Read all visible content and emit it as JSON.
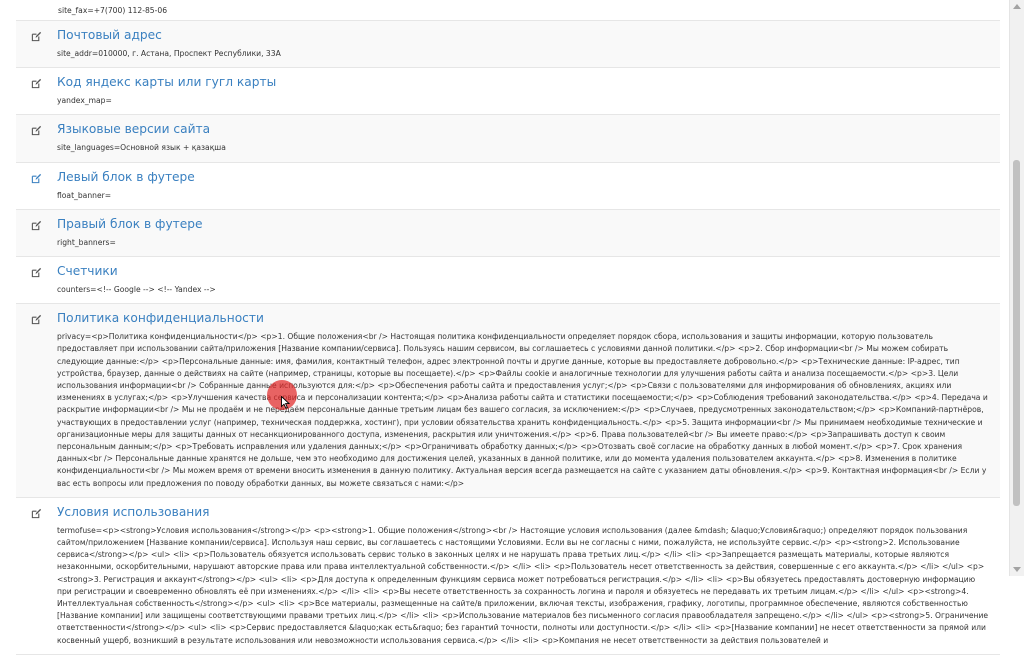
{
  "top_row": {
    "value": "site_fax=+7(700) 112-85-06"
  },
  "rows": [
    {
      "title": "Почтовый адрес",
      "value": "site_addr=010000, г. Астана, Проспект Республики, 33А"
    },
    {
      "title": "Код яндекс карты или гугл карты",
      "value": "yandex_map="
    },
    {
      "title": "Языковые версии сайта",
      "value": "site_languages=Основной язык + қазақша"
    },
    {
      "title": "Левый блок в футере",
      "value": "float_banner="
    },
    {
      "title": "Правый блок в футере",
      "value": "right_banners="
    },
    {
      "title": "Счетчики",
      "value": "counters=<!-- Google --> <!-- Yandex -->"
    },
    {
      "title": "Политика конфиденциальности",
      "value": "privacy=<p>Политика конфиденциальности</p> <p>1. Общие положения<br /> Настоящая политика конфиденциальности определяет порядок сбора, использования и защиты информации, которую пользователь предоставляет при использовании сайта/приложения [Название компании/сервиса]. Пользуясь нашим сервисом, вы соглашаетесь с условиями данной политики.</p> <p>2. Сбор информации<br /> Мы можем собирать следующие данные:</p> <p>Персональные данные: имя, фамилия, контактный телефон, адрес электронной почты и другие данные, которые вы предоставляете добровольно.</p> <p>Технические данные: IP-адрес, тип устройства, браузер, данные о действиях на сайте (например, страницы, которые вы посещаете).</p> <p>Файлы cookie и аналогичные технологии для улучшения работы сайта и анализа посещаемости.</p> <p>3. Цели использования информации<br /> Собранные данные используются для:</p> <p>Обеспечения работы сайта и предоставления услуг;</p> <p>Связи с пользователями для информирования об обновлениях, акциях или изменениях в услугах;</p> <p>Улучшения качества сервиса и персонализации контента;</p> <p>Анализа работы сайта и статистики посещаемости;</p> <p>Соблюдения требований законодательства.</p> <p>4. Передача и раскрытие информации<br /> Мы не продаём и не передаём персональные данные третьим лицам без вашего согласия, за исключением:</p> <p>Случаев, предусмотренных законодательством;</p> <p>Компаний-партнёров, участвующих в предоставлении услуг (например, техническая поддержка, хостинг), при условии обязательства хранить конфиденциальность.</p> <p>5. Защита информации<br /> Мы принимаем необходимые технические и организационные меры для защиты данных от несанкционированного доступа, изменения, раскрытия или уничтожения.</p> <p>6. Права пользователей<br /> Вы имеете право:</p> <p>Запрашивать доступ к своим персональным данным;</p> <p>Требовать исправления или удаления данных;</p> <p>Ограничивать обработку данных;</p> <p>Отозвать своё согласие на обработку данных в любой момент.</p> <p>7. Срок хранения данных<br /> Персональные данные хранятся не дольше, чем это необходимо для достижения целей, указанных в данной политике, или до момента удаления пользователем аккаунта.</p> <p>8. Изменения в политике конфиденциальности<br /> Мы можем время от времени вносить изменения в данную политику. Актуальная версия всегда размещается на сайте с указанием даты обновления.</p> <p>9. Контактная информация<br /> Если у вас есть вопросы или предложения по поводу обработки данных, вы можете связаться с нами:</p>"
    },
    {
      "title": "Условия использования",
      "value": "termofuse=<p><strong>Условия использования</strong></p> <p><strong>1. Общие положения</strong><br /> Настоящие условия использования (далее &mdash; &laquo;Условия&raquo;) определяют порядок пользования сайтом/приложением [Название компании/сервиса]. Используя наш сервис, вы соглашаетесь с настоящими Условиями. Если вы не согласны с ними, пожалуйста, не используйте сервис.</p> <p><strong>2. Использование сервиса</strong></p> <ul> <li> <p>Пользователь обязуется использовать сервис только в законных целях и не нарушать права третьих лиц.</p> </li> <li> <p>Запрещается размещать материалы, которые являются незаконными, оскорбительными, нарушают авторские права или права интеллектуальной собственности.</p> </li> <li> <p>Пользователь несет ответственность за действия, совершенные с его аккаунта.</p> </li> </ul> <p><strong>3. Регистрация и аккаунт</strong></p> <ul> <li> <p>Для доступа к определенным функциям сервиса может потребоваться регистрация.</p> </li> <li> <p>Вы обязуетесь предоставлять достоверную информацию при регистрации и своевременно обновлять её при изменениях.</p> </li> <li> <p>Вы несете ответственность за сохранность логина и пароля и обязуетесь не передавать их третьим лицам.</p> </li> </ul> <p><strong>4. Интеллектуальная собственность</strong></p> <ul> <li> <p>Все материалы, размещенные на сайте/в приложении, включая тексты, изображения, графику, логотипы, программное обеспечение, являются собственностью [Название компании] или защищены соответствующими правами третьих лиц.</p> </li> <li> <p>Использование материалов без письменного согласия правообладателя запрещено.</p> </li> </ul> <p><strong>5. Ограничение ответственности</strong></p> <ul> <li> <p>Сервис предоставляется &laquo;как есть&raquo; без гарантий точности, полноты или доступности.</p> </li> <li> <p>[Название компании] не несет ответственности за прямой или косвенный ущерб, возникший в результате использования или невозможности использования сервиса.</p> </li> <li> <p>Компания не несет ответственности за действия пользователей и"
    }
  ]
}
